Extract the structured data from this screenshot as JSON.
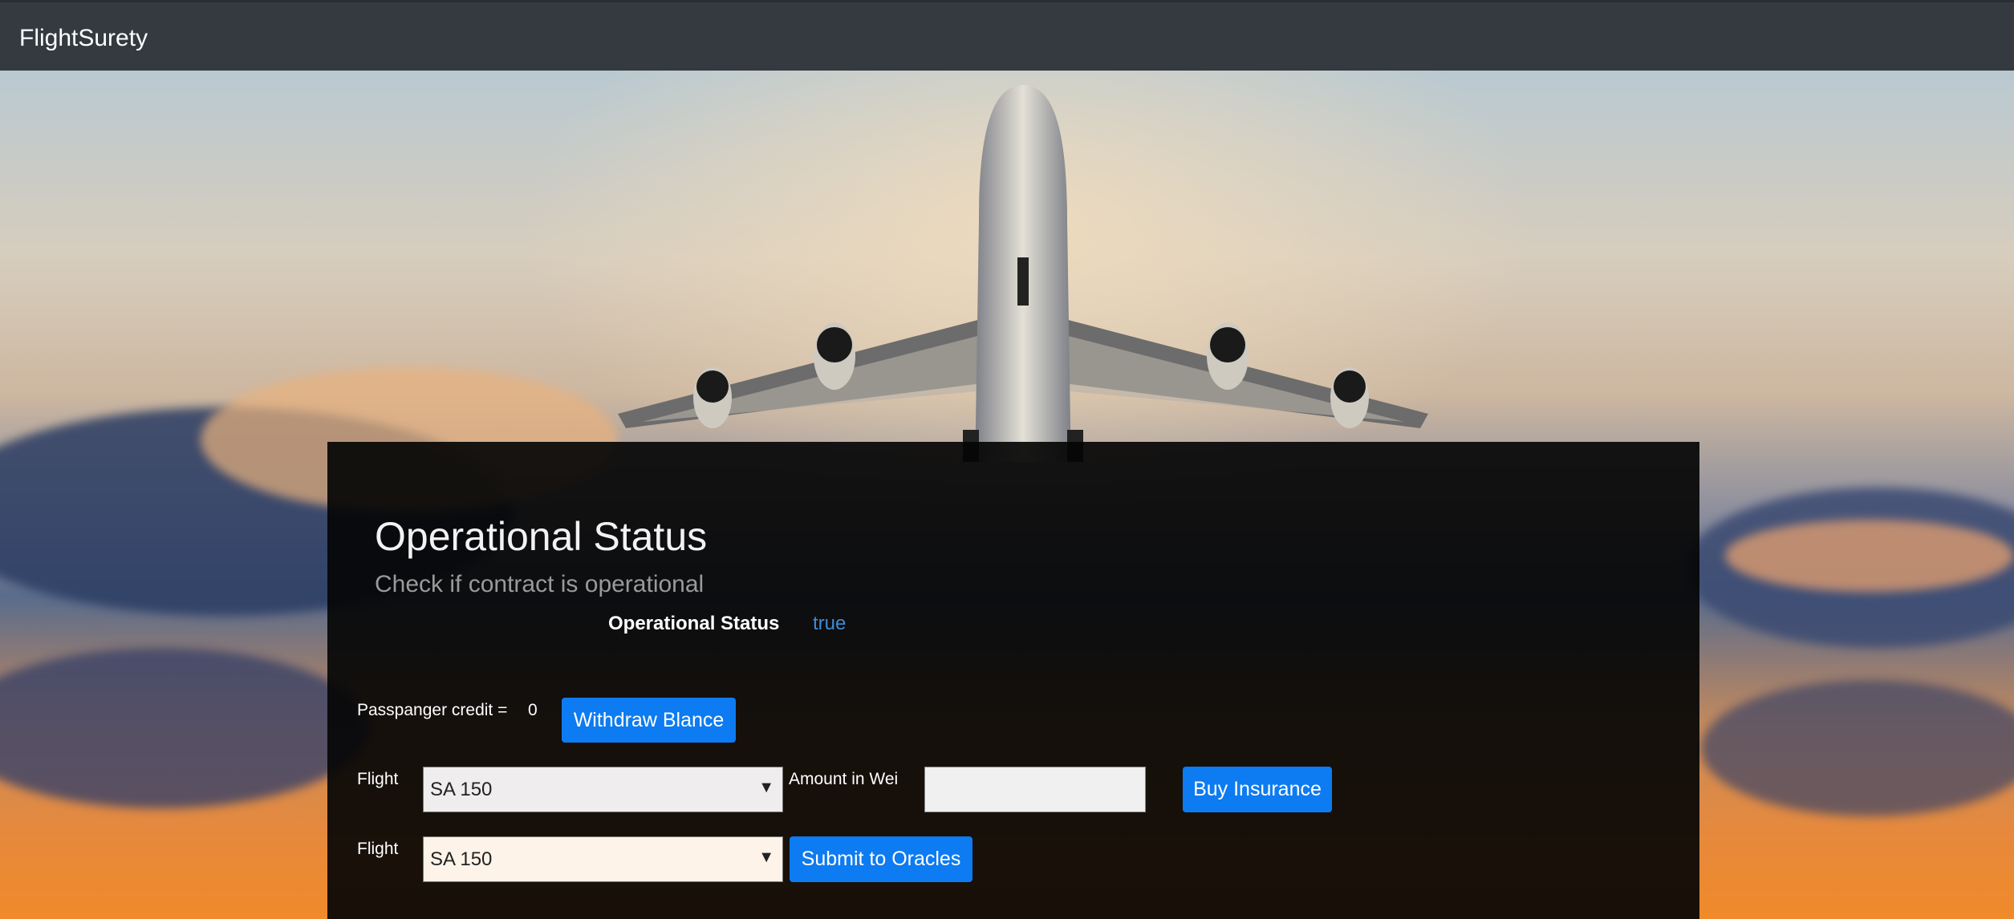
{
  "navbar": {
    "brand": "FlightSurety"
  },
  "main": {
    "title": "Operational Status",
    "subtitle": "Check if contract is operational",
    "status_label": "Operational Status",
    "status_value": "true"
  },
  "credit": {
    "label": "Passpanger credit =",
    "value": "0",
    "withdraw_button": "Withdraw Blance"
  },
  "insurance": {
    "flight_label": "Flight",
    "flight_selected": "SA 150",
    "amount_label": "Amount in Wei",
    "amount_value": "",
    "buy_button": "Buy Insurance"
  },
  "oracles": {
    "flight_label": "Flight",
    "flight_selected": "SA 150",
    "submit_button": "Submit to Oracles"
  },
  "colors": {
    "navbar_bg": "#343a40",
    "button_bg": "#0d7bf1",
    "status_value": "#3f8bd6"
  },
  "icons": {
    "select_arrow": "chevron-down-icon"
  }
}
